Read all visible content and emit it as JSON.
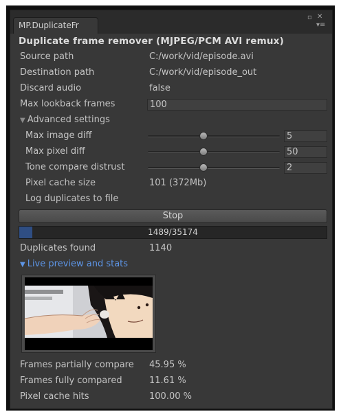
{
  "window": {
    "tab_title": "MP.DuplicateFr",
    "max_icon": "maximize-icon",
    "close_icon": "close-icon",
    "menu_icon": "menu-icon"
  },
  "panel": {
    "title": "Duplicate frame remover (MJPEG/PCM AVI remux)",
    "fields": {
      "source_path_label": "Source path",
      "source_path_value": "C:/work/vid/episode.avi",
      "destination_path_label": "Destination path",
      "destination_path_value": "C:/work/vid/episode_out",
      "discard_audio_label": "Discard audio",
      "discard_audio_value": "false",
      "max_lookback_label": "Max lookback frames",
      "max_lookback_value": "100"
    },
    "advanced": {
      "label": "Advanced settings",
      "arrow": "▼",
      "sliders": [
        {
          "label": "Max image diff",
          "value": "5",
          "thumb_fraction": 0.42
        },
        {
          "label": "Max pixel diff",
          "value": "50",
          "thumb_fraction": 0.42
        },
        {
          "label": "Tone compare distrust",
          "value": "2",
          "thumb_fraction": 0.42
        }
      ],
      "pixel_cache_label": "Pixel cache size",
      "pixel_cache_value": "101 (372Mb)",
      "log_duplicates_label": "Log duplicates to file"
    },
    "stop_button": "Stop",
    "progress": {
      "text": "1489/35174",
      "fraction": 0.042
    },
    "duplicates_label": "Duplicates found",
    "duplicates_value": "1140",
    "live_preview": {
      "label": "Live preview and stats",
      "arrow": "▼"
    },
    "stats": [
      {
        "label": "Frames partially compare",
        "value": "45.95 %"
      },
      {
        "label": "Frames fully compared",
        "value": "11.61 %"
      },
      {
        "label": "Pixel cache hits",
        "value": "100.00 %"
      }
    ]
  },
  "colors": {
    "panel_bg": "#383838",
    "accent_blue": "#5d95e6",
    "progress_fill": "#2f4e83"
  }
}
